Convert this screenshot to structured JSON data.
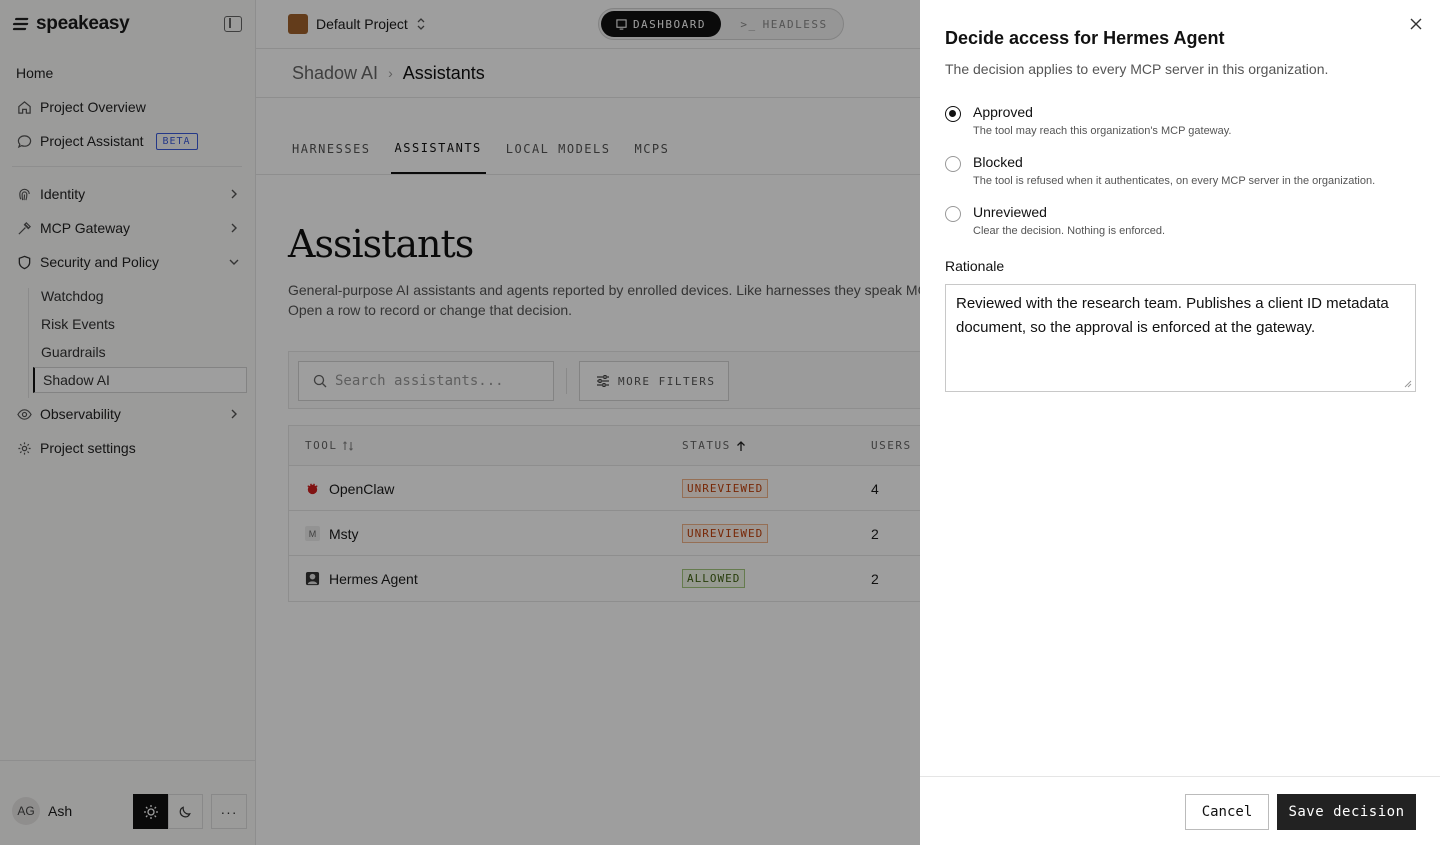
{
  "brand": {
    "name": "speakeasy"
  },
  "sidebar": {
    "items": [
      {
        "label": "Home",
        "icon": "home-icon"
      },
      {
        "label": "Project Overview",
        "icon": "house-icon"
      },
      {
        "label": "Project Assistant",
        "icon": "chat-icon",
        "badge": "BETA"
      },
      {
        "label": "Identity",
        "icon": "fingerprint-icon"
      },
      {
        "label": "MCP Gateway",
        "icon": "hammer-icon"
      },
      {
        "label": "Security and Policy",
        "icon": "shield-icon"
      },
      {
        "label": "Observability",
        "icon": "eye-icon"
      },
      {
        "label": "Project settings",
        "icon": "gear-icon"
      }
    ],
    "security_subitems": [
      "Watchdog",
      "Risk Events",
      "Guardrails",
      "Shadow AI"
    ],
    "user": {
      "initials": "AG",
      "name": "Ash"
    }
  },
  "topbar": {
    "project": "Default Project",
    "modes": {
      "dashboard": "DASHBOARD",
      "headless": "HEADLESS"
    }
  },
  "breadcrumb": {
    "parent": "Shadow AI",
    "current": "Assistants"
  },
  "tabs": [
    "HARNESSES",
    "ASSISTANTS",
    "LOCAL MODELS",
    "MCPS"
  ],
  "page": {
    "title": "Assistants",
    "desc_line1": "General-purpose AI assistants and agents reported by enrolled devices. Like harnesses they speak MCI",
    "desc_line2": "Open a row to record or change that decision."
  },
  "filters": {
    "search_placeholder": "Search assistants...",
    "more_filters": "MORE FILTERS"
  },
  "table": {
    "headers": {
      "tool": "TOOL",
      "status": "STATUS",
      "users": "USERS"
    },
    "rows": [
      {
        "tool": "OpenClaw",
        "status": "UNREVIEWED",
        "users": "4"
      },
      {
        "tool": "Msty",
        "status": "UNREVIEWED",
        "users": "2"
      },
      {
        "tool": "Hermes Agent",
        "status": "ALLOWED",
        "users": "2"
      }
    ]
  },
  "drawer": {
    "title": "Decide access for Hermes Agent",
    "subtitle": "The decision applies to every MCP server in this organization.",
    "options": [
      {
        "label": "Approved",
        "help": "The tool may reach this organization's MCP gateway.",
        "selected": true
      },
      {
        "label": "Blocked",
        "help": "The tool is refused when it authenticates, on every MCP server in the organization.",
        "selected": false
      },
      {
        "label": "Unreviewed",
        "help": "Clear the decision. Nothing is enforced.",
        "selected": false
      }
    ],
    "rationale_label": "Rationale",
    "rationale_text": "Reviewed with the research team. Publishes a client ID metadata document, so the approval is enforced at the gateway.",
    "cancel": "Cancel",
    "save": "Save decision"
  },
  "colors": {
    "accent": "#111111",
    "unreviewed": "#c2410c",
    "allowed": "#3f6212",
    "beta": "#3b5bdb"
  }
}
